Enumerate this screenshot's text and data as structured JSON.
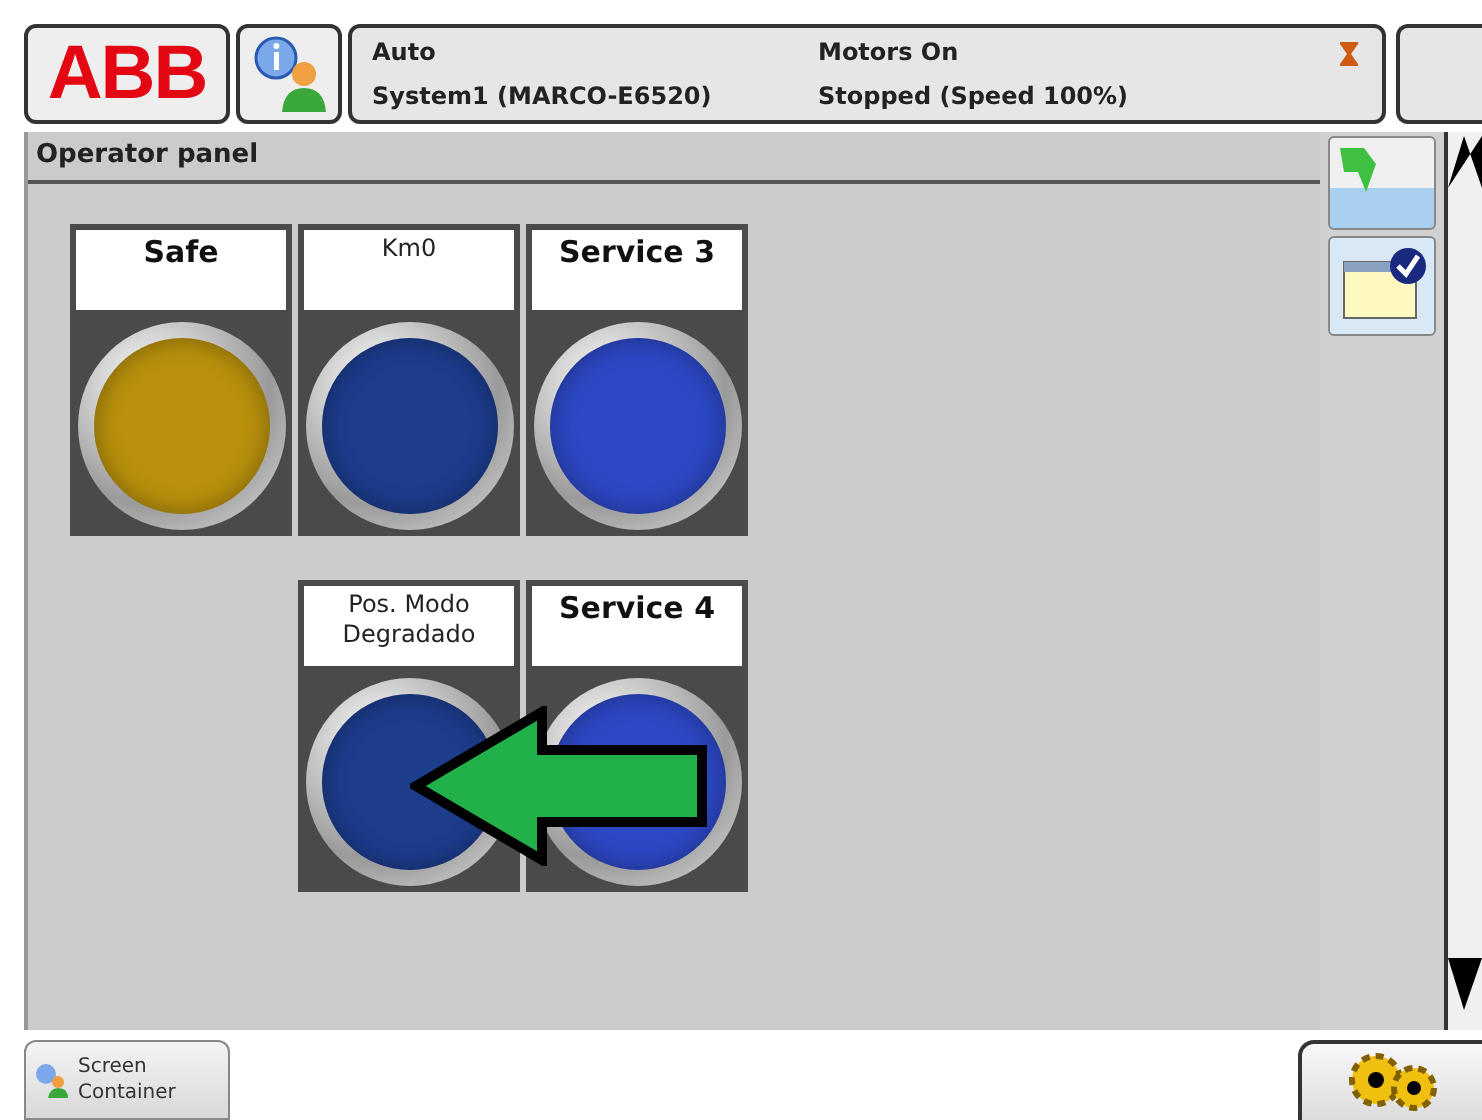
{
  "header": {
    "logo": "ABB",
    "mode": "Auto",
    "system": "System1 (MARCO-E6520)",
    "motors": "Motors On",
    "state": "Stopped (Speed 100%)"
  },
  "panel": {
    "title": "Operator panel"
  },
  "rows": [
    {
      "cells": [
        {
          "kind": "lamp",
          "label": "Safe",
          "bold": true,
          "color": "#b8900c"
        },
        {
          "kind": "lamp",
          "label": "Km0",
          "bold": false,
          "color": "#1c3c8c"
        },
        {
          "kind": "lamp",
          "label": "Service 3",
          "bold": true,
          "color": "#2c48c4"
        }
      ]
    },
    {
      "cells": [
        {
          "kind": "empty"
        },
        {
          "kind": "lamp",
          "label": "Pos. Modo Degradado",
          "bold": false,
          "color": "#1c3c8c"
        },
        {
          "kind": "lamp",
          "label": "Service 4",
          "bold": true,
          "color": "#2c48c4"
        }
      ]
    }
  ],
  "taskbar": {
    "label": "Screen Container"
  }
}
